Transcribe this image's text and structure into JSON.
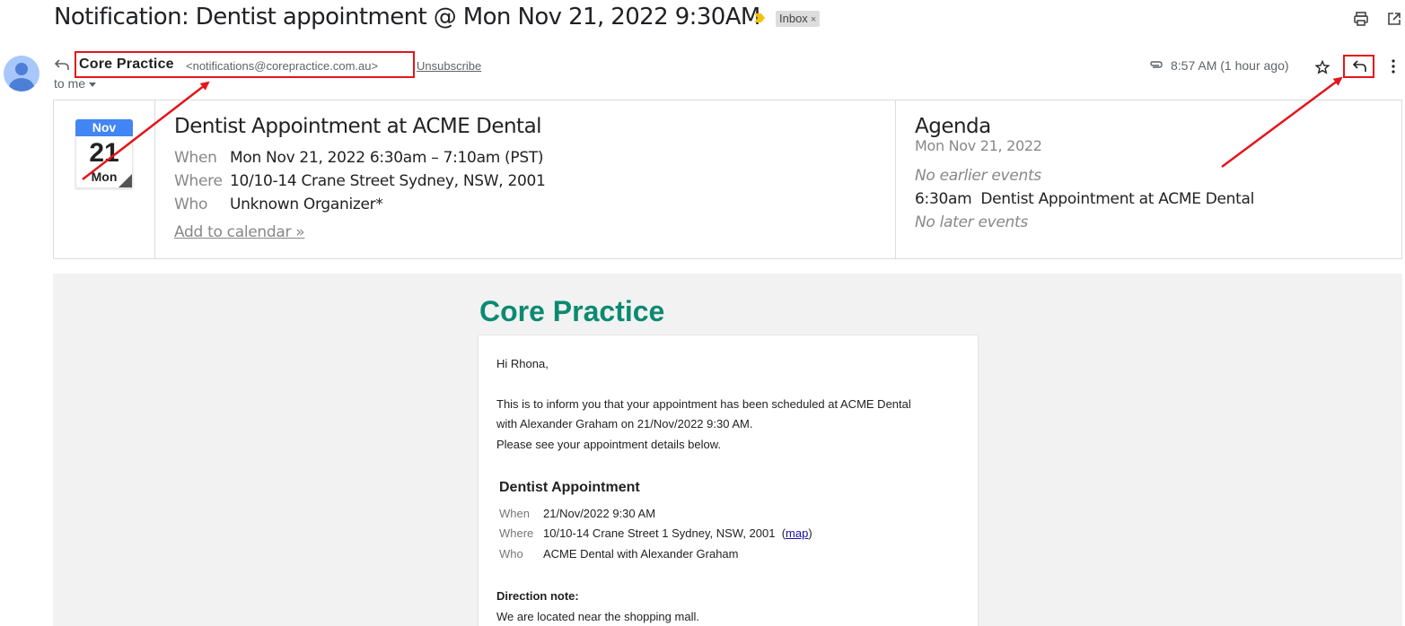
{
  "header": {
    "subject": "Notification: Dentist appointment @ Mon Nov 21, 2022 9:30AM",
    "label": "Inbox",
    "label_remove": "×",
    "icons": [
      "importance-marker-icon",
      "print-icon",
      "open-in-new-window-icon"
    ]
  },
  "sender": {
    "name": "Core Practice",
    "email": "<notifications@corepractice.com.au>",
    "unsubscribe": "Unsubscribe",
    "recipient": "to me",
    "timestamp": "8:57 AM (1 hour ago)",
    "icons": [
      "avatar-icon",
      "reply-icon",
      "attachment-icon",
      "star-icon",
      "reply-icon",
      "more-vert-icon"
    ]
  },
  "calendar_card": {
    "month": "Nov",
    "day": "21",
    "weekday": "Mon",
    "title": "Dentist Appointment at ACME Dental",
    "rows": [
      {
        "label": "When",
        "value": "Mon Nov 21, 2022 6:30am – 7:10am (PST)"
      },
      {
        "label": "Where",
        "value": "10/10-14 Crane Street Sydney, NSW, 2001"
      },
      {
        "label": "Who",
        "value": "Unknown Organizer*"
      }
    ],
    "add_link": "Add to calendar »",
    "agenda": {
      "title": "Agenda",
      "date": "Mon Nov 21, 2022",
      "no_earlier": "No earlier events",
      "event_time": "6:30am",
      "event_title": "Dentist Appointment at ACME Dental",
      "no_later": "No later events"
    }
  },
  "body": {
    "brand": "Core Practice",
    "greeting": "Hi Rhona,",
    "lines": [
      "This is to inform you that your appointment has been scheduled at ACME Dental",
      "with Alexander Graham on 21/Nov/2022 9:30 AM.",
      "Please see your appointment details below."
    ],
    "appointment": {
      "title": "Dentist Appointment",
      "rows": [
        {
          "label": "When",
          "value": "21/Nov/2022 9:30 AM"
        },
        {
          "label": "Where",
          "value": "10/10-14 Crane Street 1 Sydney, NSW, 2001"
        },
        {
          "label": "Who",
          "value": "ACME Dental with Alexander Graham"
        }
      ],
      "map_open": "(",
      "map_link": "map",
      "map_close": ")"
    },
    "direction_title": "Direction note:",
    "direction_text": "We are located near the shopping mall."
  },
  "annotations": {
    "color": "#e3161b"
  }
}
